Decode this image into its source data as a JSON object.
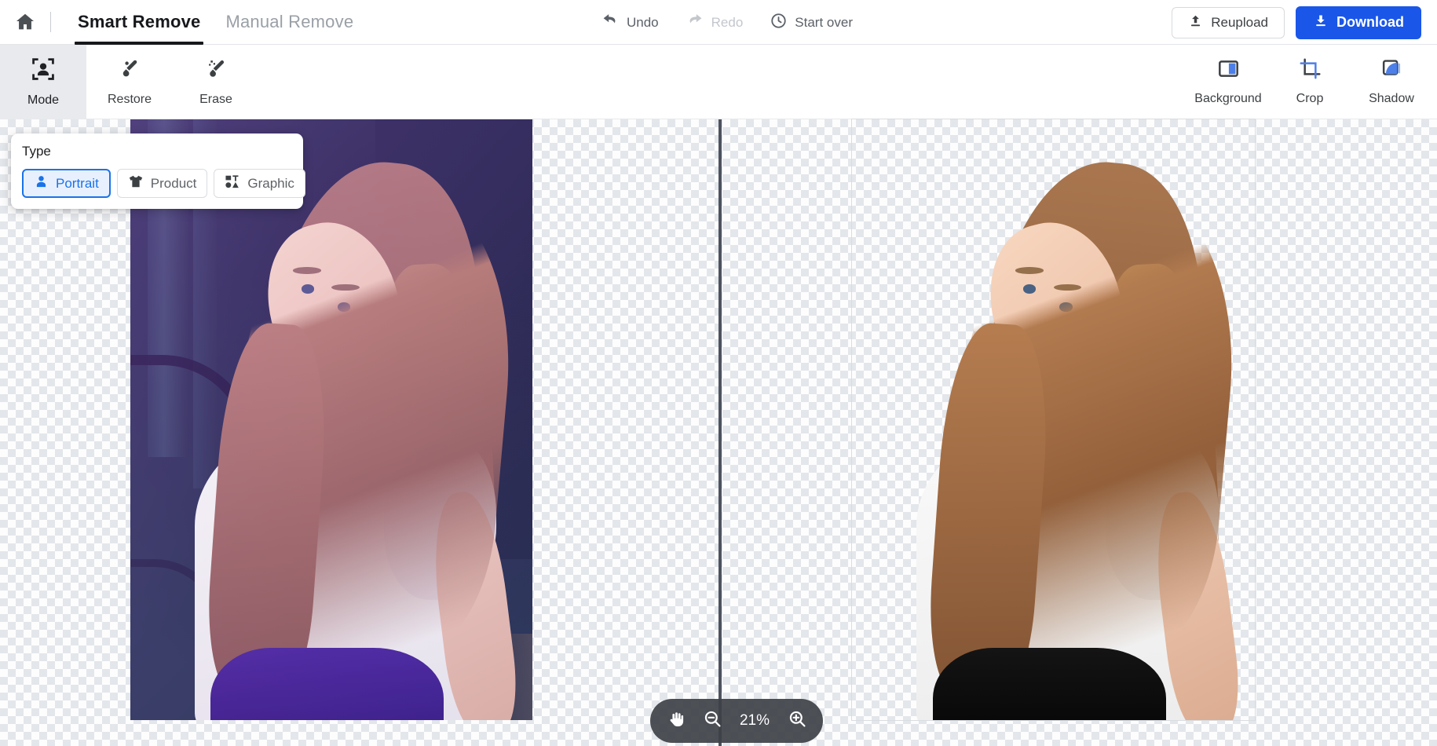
{
  "header": {
    "home_icon": "home-icon",
    "tabs": [
      {
        "label": "Smart Remove",
        "active": true
      },
      {
        "label": "Manual Remove",
        "active": false
      }
    ],
    "actions": [
      {
        "label": "Undo",
        "icon": "undo-arrow-icon",
        "disabled": false
      },
      {
        "label": "Redo",
        "icon": "redo-arrow-icon",
        "disabled": true
      },
      {
        "label": "Start over",
        "icon": "history-clock-icon",
        "disabled": false
      }
    ],
    "reupload_label": "Reupload",
    "reupload_icon": "upload-icon",
    "download_label": "Download",
    "download_icon": "download-icon",
    "download_color": "#1a56e8"
  },
  "toolbar": {
    "left_tools": [
      {
        "label": "Mode",
        "icon": "portrait-frame-icon",
        "selected": true
      },
      {
        "label": "Restore",
        "icon": "restore-brush-icon",
        "selected": false
      },
      {
        "label": "Erase",
        "icon": "erase-brush-icon",
        "selected": false
      }
    ],
    "right_tools": [
      {
        "label": "Background",
        "icon": "background-panel-icon"
      },
      {
        "label": "Crop",
        "icon": "crop-icon"
      },
      {
        "label": "Shadow",
        "icon": "shadow-icon"
      }
    ],
    "accent_color": "#4d7fe8"
  },
  "type_panel": {
    "title": "Type",
    "options": [
      {
        "label": "Portrait",
        "icon": "person-icon",
        "selected": true
      },
      {
        "label": "Product",
        "icon": "tshirt-icon",
        "selected": false
      },
      {
        "label": "Graphic",
        "icon": "shapes-icon",
        "selected": false
      }
    ],
    "selected_color": "#1a73e8"
  },
  "canvas": {
    "left_image_alt": "Original photo: smiling woman with long hair, dark teal interior background, purple lighting",
    "right_image_alt": "Background-removed cutout of the same woman on transparent checkerboard",
    "divider_color": "#4e535f",
    "checker_light": "#fdfdfe",
    "checker_dark": "#e3e6ea"
  },
  "zoom_control": {
    "pan_icon": "hand-icon",
    "zoom_out_icon": "zoom-out-icon",
    "zoom_in_icon": "zoom-in-icon",
    "level": "21%"
  }
}
